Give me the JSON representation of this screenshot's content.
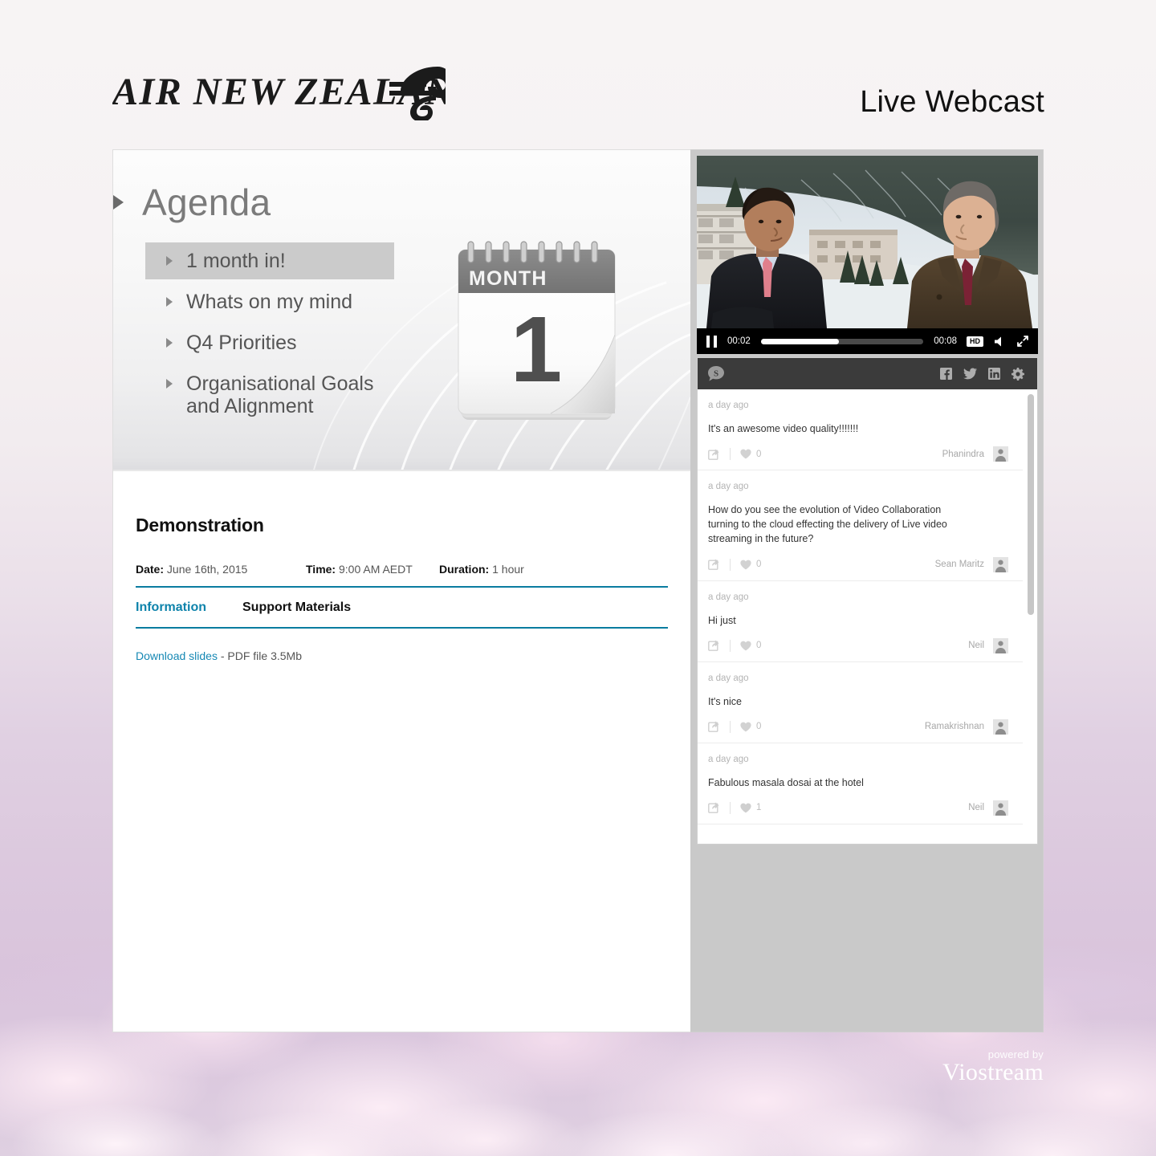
{
  "header": {
    "brand": "AIR NEW ZEALAND",
    "page_title": "Live Webcast"
  },
  "slide": {
    "title": "Agenda",
    "items": [
      {
        "label": "1 month in!",
        "active": true
      },
      {
        "label": "Whats on my mind",
        "active": false
      },
      {
        "label": "Q4 Priorities",
        "active": false
      },
      {
        "label": "Organisational Goals and Alignment",
        "active": false
      }
    ],
    "calendar": {
      "month_label": "MONTH",
      "day_number": "1"
    }
  },
  "detail": {
    "title": "Demonstration",
    "date_label": "Date:",
    "date_value": "June 16th, 2015",
    "time_label": "Time:",
    "time_value": "9:00 AM AEDT",
    "duration_label": "Duration:",
    "duration_value": "1 hour",
    "tabs": [
      {
        "label": "Information",
        "active": true
      },
      {
        "label": "Support Materials",
        "active": false
      }
    ],
    "download_link": "Download slides",
    "download_meta": "- PDF file 3.5Mb",
    "accent_color": "#0a7ca0",
    "link_color": "#1688b4"
  },
  "video": {
    "current_time": "00:02",
    "duration": "00:08",
    "quality_badge": "HD",
    "progress_percent": 48,
    "state": "playing"
  },
  "chat": {
    "logo_letter": "S",
    "social": [
      "facebook-icon",
      "twitter-icon",
      "linkedin-icon",
      "gear-icon"
    ],
    "messages": [
      {
        "time": "a day ago",
        "text": "It's an awesome video quality!!!!!!!",
        "likes": "0",
        "author": "Phanindra"
      },
      {
        "time": "a day ago",
        "text": "How do you see the evolution of Video Collaboration turning to the cloud effecting the delivery of Live video streaming in the future?",
        "likes": "0",
        "author": "Sean Maritz"
      },
      {
        "time": "a day ago",
        "text": "Hi just",
        "likes": "0",
        "author": "Neil"
      },
      {
        "time": "a day ago",
        "text": "It's nice",
        "likes": "0",
        "author": "Ramakrishnan"
      },
      {
        "time": "a day ago",
        "text": "Fabulous masala dosai at the hotel",
        "likes": "1",
        "author": "Neil"
      }
    ]
  },
  "footer": {
    "powered_by": "powered by",
    "brand": "Viostream"
  }
}
